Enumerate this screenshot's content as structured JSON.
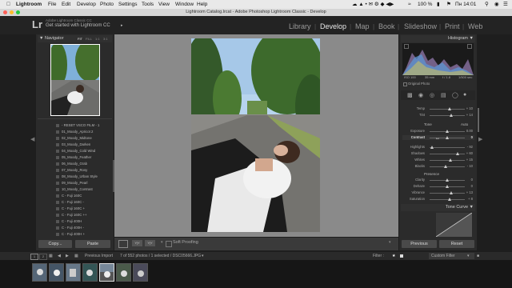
{
  "menubar": {
    "apple": "",
    "items": [
      "Lightroom",
      "File",
      "Edit",
      "Develop",
      "Photo",
      "Settings",
      "Tools",
      "View",
      "Window",
      "Help"
    ],
    "battery": "100 %",
    "clock": "Пн 14:01"
  },
  "titlebar": {
    "title": "Lightroom Catalog.lrcat - Adobe Photoshop Lightroom Classic - Develop"
  },
  "identity": {
    "logo": "Lr",
    "line1": "Adobe Lightroom Classic CC",
    "line2": "Get started with Lightroom CC",
    "modules": [
      "Library",
      "Develop",
      "Map",
      "Book",
      "Slideshow",
      "Print",
      "Web"
    ],
    "active_module": "Develop"
  },
  "navigator": {
    "title": "Navigator",
    "zoom": [
      "FIT",
      "FILL",
      "1:1",
      "3:1"
    ]
  },
  "presets": [
    "- RESET VSCO FILM - 1",
    "01_Moody_Apricot 2",
    "02_Moody_Midtone",
    "03_Moody_Darken",
    "04_Moody_Cold Wind",
    "05_Moody_Feather",
    "06_Moody_Grab",
    "07_Moody_Rosy",
    "08_Moody_Urban Style",
    "09_Moody_Pearl",
    "10_Moody_Contrast",
    "C - Fuji 160C",
    "C - Fuji 160C -",
    "C - Fuji 160C +",
    "C - Fuji 160C ++",
    "C - Fuji 400H",
    "C - Fuji 400H -",
    "C - Fuji 400H +"
  ],
  "left_buttons": {
    "copy": "Copy...",
    "paste": "Paste"
  },
  "histogram": {
    "title": "Histogram",
    "info": [
      "ISO 100",
      "35 mm",
      "f / 1.8",
      "1/500 sec"
    ],
    "original_photo": "Original Photo"
  },
  "basic": {
    "wb": [
      {
        "label": "Temp",
        "value": "+ 10"
      },
      {
        "label": "Tint",
        "value": "+ 14"
      }
    ],
    "tone_title": "Tone",
    "auto": "Auto",
    "tone": [
      {
        "label": "Exposure",
        "value": "0.00"
      },
      {
        "label": "Contrast",
        "value": "0"
      },
      {
        "label": "Highlights",
        "value": "- 92"
      },
      {
        "label": "Shadows",
        "value": "+ 60"
      },
      {
        "label": "Whites",
        "value": "+ 15"
      },
      {
        "label": "Blacks",
        "value": "- 10"
      }
    ],
    "presence_title": "Presence",
    "presence": [
      {
        "label": "Clarity",
        "value": "0"
      },
      {
        "label": "Dehaze",
        "value": "0"
      },
      {
        "label": "Vibrance",
        "value": "+ 13"
      },
      {
        "label": "Saturation",
        "value": "+ 8"
      }
    ]
  },
  "tone_curve": {
    "title": "Tone Curve"
  },
  "right_buttons": {
    "previous": "Previous",
    "reset": "Reset"
  },
  "toolbar": {
    "soft_proofing": "Soft Proofing"
  },
  "filmbar": {
    "pages": [
      "1",
      "2"
    ],
    "source": "Previous Import",
    "info": "7 of 552 photos / 1 selected / DSC05666.JPG",
    "filter_label": "Filter :",
    "filter_value": "Custom Filter"
  },
  "colors": {
    "accent_active": "#e0e0e0",
    "panel": "#2b2b2b",
    "center_bg": "#8a8a8a"
  }
}
